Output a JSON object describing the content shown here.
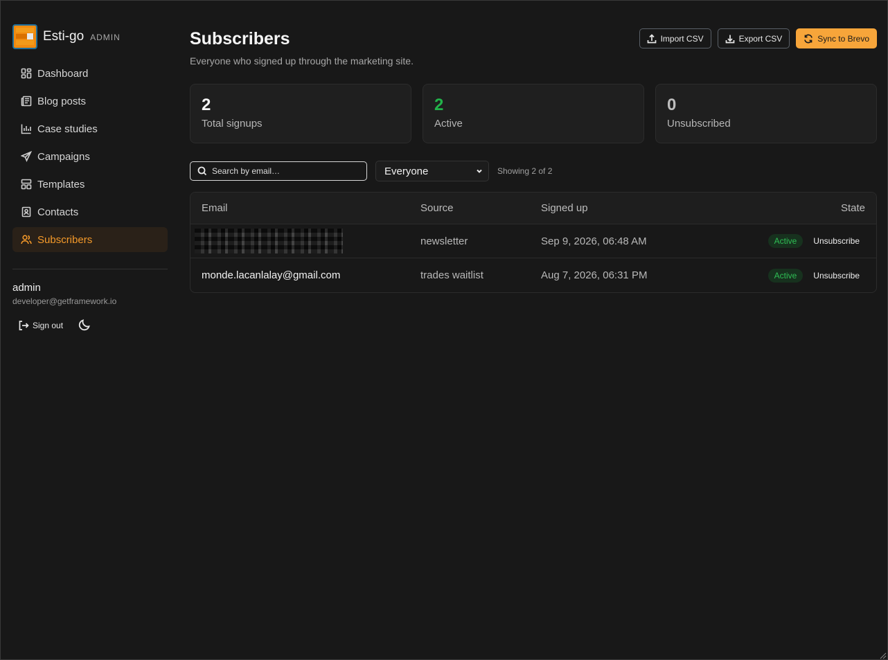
{
  "brand": {
    "name": "Esti-go",
    "tag": "ADMIN"
  },
  "sidebar": {
    "items": [
      {
        "label": "Dashboard",
        "icon": "dashboard-icon",
        "active": false
      },
      {
        "label": "Blog posts",
        "icon": "newspaper-icon",
        "active": false
      },
      {
        "label": "Case studies",
        "icon": "bar-chart-icon",
        "active": false
      },
      {
        "label": "Campaigns",
        "icon": "send-icon",
        "active": false
      },
      {
        "label": "Templates",
        "icon": "layout-icon",
        "active": false
      },
      {
        "label": "Contacts",
        "icon": "contact-book-icon",
        "active": false
      },
      {
        "label": "Subscribers",
        "icon": "users-icon",
        "active": true
      }
    ],
    "user": {
      "name": "admin",
      "email": "developer@getframework.io"
    },
    "sign_out_label": "Sign out"
  },
  "header": {
    "title": "Subscribers",
    "subtitle": "Everyone who signed up through the marketing site.",
    "actions": {
      "import_label": "Import CSV",
      "export_label": "Export CSV",
      "sync_label": "Sync to Brevo"
    }
  },
  "stats": [
    {
      "value": "2",
      "label": "Total signups"
    },
    {
      "value": "2",
      "label": "Active"
    },
    {
      "value": "0",
      "label": "Unsubscribed"
    }
  ],
  "filters": {
    "search_placeholder": "Search by email…",
    "select_value": "Everyone",
    "showing": "Showing 2 of 2"
  },
  "table": {
    "headers": {
      "email": "Email",
      "source": "Source",
      "signed_up": "Signed up",
      "state": "State"
    },
    "rows": [
      {
        "email": "",
        "redacted": true,
        "source": "newsletter",
        "signed_up": "Sep 9, 2026, 06:48 AM",
        "state": "Active",
        "action": "Unsubscribe"
      },
      {
        "email": "monde.lacanlalay@gmail.com",
        "redacted": false,
        "source": "trades waitlist",
        "signed_up": "Aug 7, 2026, 06:31 PM",
        "state": "Active",
        "action": "Unsubscribe"
      }
    ]
  },
  "colors": {
    "accent": "#f7a53a",
    "active_green": "#22b34a",
    "background": "#181818"
  }
}
